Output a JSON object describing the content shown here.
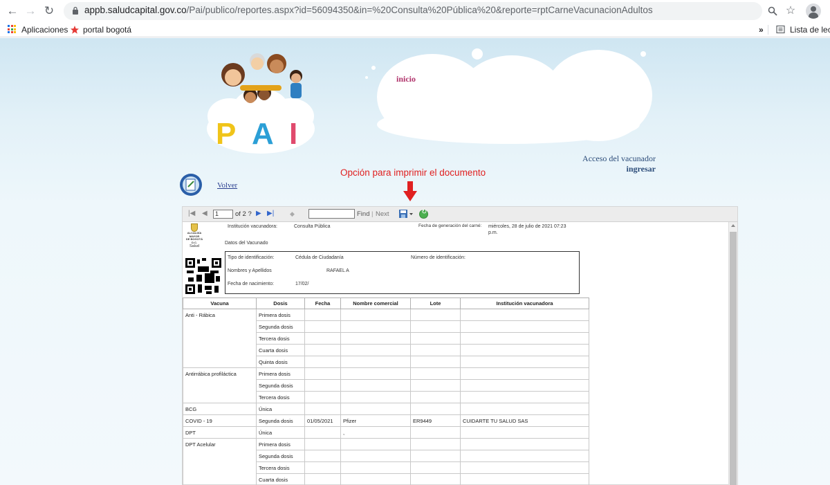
{
  "browser": {
    "url_host": "appb.saludcapital.gov.co",
    "url_path": "/Pai/publico/reportes.aspx?id=56094350&in=%20Consulta%20Pública%20&reporte=rptCarneVacunacionAdultos",
    "bookmarks": [
      {
        "label": "Aplicaciones"
      },
      {
        "label": "portal bogotá"
      }
    ],
    "bookmarks_overflow": "»",
    "reading_list": "Lista de lectu"
  },
  "header": {
    "logo_letters": [
      "P",
      "A",
      "I"
    ],
    "inicio": "inicio",
    "acceso_label": "Acceso del vacunador",
    "ingresar": "ingresar",
    "volver": "Volver"
  },
  "annotation": {
    "text": "Opción para imprimir el documento",
    "color": "#e02020"
  },
  "toolbar": {
    "page_value": "1",
    "page_of": "of 2 ?",
    "find": "Find",
    "separator": "|",
    "next": "Next"
  },
  "report": {
    "logo_line1": "ALCALDÍA MAYOR",
    "logo_line2": "DE BOGOTÁ D.C.",
    "logo_line3": "Salud",
    "institucion_label": "Institución vacunadora:",
    "institucion_value": "Consulta Pública",
    "fecha_gen_label": "Fecha de generación del carné:",
    "fecha_gen_value_1": "miércoles, 28 de julio de 2021 07:23",
    "fecha_gen_value_2": "p.m.",
    "datos_title": "Datos del Vacunado",
    "tipo_id_label": "Tipo de identificación:",
    "tipo_id_value": "Cédula de Ciudadanía",
    "num_id_label": "Número de identificación:",
    "nombres_label": "Nombres y Apellidos",
    "nombres_value": "RAFAEL A",
    "nacimiento_label": "Fecha de nacimiento:",
    "nacimiento_value": "17/02/"
  },
  "table": {
    "headers": [
      "Vacuna",
      "Dosis",
      "Fecha",
      "Nombre comercial",
      "Lote",
      "Institución vacunadora"
    ],
    "groups": [
      {
        "vacuna": "Anti - Rábica",
        "rows": [
          {
            "dosis": "Primera dosis",
            "fecha": "",
            "nombre": "",
            "lote": "",
            "inst": ""
          },
          {
            "dosis": "Segunda dosis",
            "fecha": "",
            "nombre": "",
            "lote": "",
            "inst": ""
          },
          {
            "dosis": "Tercera dosis",
            "fecha": "",
            "nombre": "",
            "lote": "",
            "inst": ""
          },
          {
            "dosis": "Cuarta dosis",
            "fecha": "",
            "nombre": "",
            "lote": "",
            "inst": ""
          },
          {
            "dosis": "Quinta dosis",
            "fecha": "",
            "nombre": "",
            "lote": "",
            "inst": ""
          }
        ]
      },
      {
        "vacuna": "Antirrábica profiláctica",
        "rows": [
          {
            "dosis": "Primera dosis",
            "fecha": "",
            "nombre": "",
            "lote": "",
            "inst": ""
          },
          {
            "dosis": "Segunda dosis",
            "fecha": "",
            "nombre": "",
            "lote": "",
            "inst": ""
          },
          {
            "dosis": "Tercera dosis",
            "fecha": "",
            "nombre": "",
            "lote": "",
            "inst": ""
          }
        ]
      },
      {
        "vacuna": "BCG",
        "rows": [
          {
            "dosis": "Única",
            "fecha": "",
            "nombre": "",
            "lote": "",
            "inst": ""
          }
        ]
      },
      {
        "vacuna": "COVID - 19",
        "rows": [
          {
            "dosis": "Segunda dosis",
            "fecha": "01/05/2021",
            "nombre": "Pfizer",
            "lote": "ER9449",
            "inst": "CUIDARTE TU SALUD SAS"
          }
        ]
      },
      {
        "vacuna": "DPT",
        "rows": [
          {
            "dosis": "Única",
            "fecha": "",
            "nombre": ",",
            "lote": "",
            "inst": ""
          }
        ]
      },
      {
        "vacuna": "DPT Acelular",
        "rows": [
          {
            "dosis": "Primera dosis",
            "fecha": "",
            "nombre": "",
            "lote": "",
            "inst": ""
          },
          {
            "dosis": "Segunda dosis",
            "fecha": "",
            "nombre": "",
            "lote": "",
            "inst": ""
          },
          {
            "dosis": "Tercera dosis",
            "fecha": "",
            "nombre": "",
            "lote": "",
            "inst": ""
          },
          {
            "dosis": "Cuarta dosis",
            "fecha": "",
            "nombre": "",
            "lote": "",
            "inst": ""
          }
        ]
      }
    ]
  },
  "icons": {
    "back": "back-arrow-icon",
    "forward": "forward-arrow-icon",
    "reload": "reload-icon",
    "lock": "lock-icon",
    "zoom": "zoom-icon",
    "star": "star-icon",
    "save": "save-export-icon",
    "refresh": "refresh-icon"
  }
}
